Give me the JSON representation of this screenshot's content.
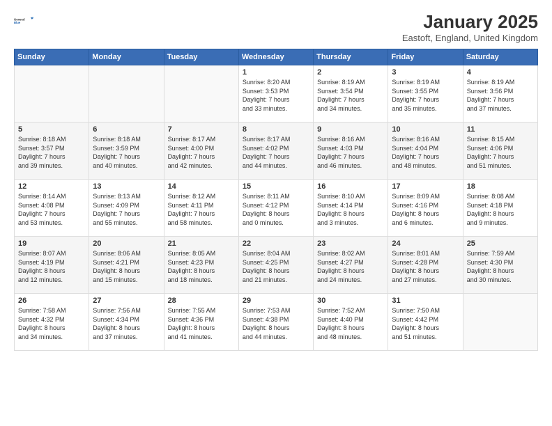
{
  "logo": {
    "line1": "General",
    "line2": "Blue"
  },
  "title": "January 2025",
  "subtitle": "Eastoft, England, United Kingdom",
  "weekdays": [
    "Sunday",
    "Monday",
    "Tuesday",
    "Wednesday",
    "Thursday",
    "Friday",
    "Saturday"
  ],
  "weeks": [
    [
      {
        "day": "",
        "info": ""
      },
      {
        "day": "",
        "info": ""
      },
      {
        "day": "",
        "info": ""
      },
      {
        "day": "1",
        "info": "Sunrise: 8:20 AM\nSunset: 3:53 PM\nDaylight: 7 hours\nand 33 minutes."
      },
      {
        "day": "2",
        "info": "Sunrise: 8:19 AM\nSunset: 3:54 PM\nDaylight: 7 hours\nand 34 minutes."
      },
      {
        "day": "3",
        "info": "Sunrise: 8:19 AM\nSunset: 3:55 PM\nDaylight: 7 hours\nand 35 minutes."
      },
      {
        "day": "4",
        "info": "Sunrise: 8:19 AM\nSunset: 3:56 PM\nDaylight: 7 hours\nand 37 minutes."
      }
    ],
    [
      {
        "day": "5",
        "info": "Sunrise: 8:18 AM\nSunset: 3:57 PM\nDaylight: 7 hours\nand 39 minutes."
      },
      {
        "day": "6",
        "info": "Sunrise: 8:18 AM\nSunset: 3:59 PM\nDaylight: 7 hours\nand 40 minutes."
      },
      {
        "day": "7",
        "info": "Sunrise: 8:17 AM\nSunset: 4:00 PM\nDaylight: 7 hours\nand 42 minutes."
      },
      {
        "day": "8",
        "info": "Sunrise: 8:17 AM\nSunset: 4:02 PM\nDaylight: 7 hours\nand 44 minutes."
      },
      {
        "day": "9",
        "info": "Sunrise: 8:16 AM\nSunset: 4:03 PM\nDaylight: 7 hours\nand 46 minutes."
      },
      {
        "day": "10",
        "info": "Sunrise: 8:16 AM\nSunset: 4:04 PM\nDaylight: 7 hours\nand 48 minutes."
      },
      {
        "day": "11",
        "info": "Sunrise: 8:15 AM\nSunset: 4:06 PM\nDaylight: 7 hours\nand 51 minutes."
      }
    ],
    [
      {
        "day": "12",
        "info": "Sunrise: 8:14 AM\nSunset: 4:08 PM\nDaylight: 7 hours\nand 53 minutes."
      },
      {
        "day": "13",
        "info": "Sunrise: 8:13 AM\nSunset: 4:09 PM\nDaylight: 7 hours\nand 55 minutes."
      },
      {
        "day": "14",
        "info": "Sunrise: 8:12 AM\nSunset: 4:11 PM\nDaylight: 7 hours\nand 58 minutes."
      },
      {
        "day": "15",
        "info": "Sunrise: 8:11 AM\nSunset: 4:12 PM\nDaylight: 8 hours\nand 0 minutes."
      },
      {
        "day": "16",
        "info": "Sunrise: 8:10 AM\nSunset: 4:14 PM\nDaylight: 8 hours\nand 3 minutes."
      },
      {
        "day": "17",
        "info": "Sunrise: 8:09 AM\nSunset: 4:16 PM\nDaylight: 8 hours\nand 6 minutes."
      },
      {
        "day": "18",
        "info": "Sunrise: 8:08 AM\nSunset: 4:18 PM\nDaylight: 8 hours\nand 9 minutes."
      }
    ],
    [
      {
        "day": "19",
        "info": "Sunrise: 8:07 AM\nSunset: 4:19 PM\nDaylight: 8 hours\nand 12 minutes."
      },
      {
        "day": "20",
        "info": "Sunrise: 8:06 AM\nSunset: 4:21 PM\nDaylight: 8 hours\nand 15 minutes."
      },
      {
        "day": "21",
        "info": "Sunrise: 8:05 AM\nSunset: 4:23 PM\nDaylight: 8 hours\nand 18 minutes."
      },
      {
        "day": "22",
        "info": "Sunrise: 8:04 AM\nSunset: 4:25 PM\nDaylight: 8 hours\nand 21 minutes."
      },
      {
        "day": "23",
        "info": "Sunrise: 8:02 AM\nSunset: 4:27 PM\nDaylight: 8 hours\nand 24 minutes."
      },
      {
        "day": "24",
        "info": "Sunrise: 8:01 AM\nSunset: 4:28 PM\nDaylight: 8 hours\nand 27 minutes."
      },
      {
        "day": "25",
        "info": "Sunrise: 7:59 AM\nSunset: 4:30 PM\nDaylight: 8 hours\nand 30 minutes."
      }
    ],
    [
      {
        "day": "26",
        "info": "Sunrise: 7:58 AM\nSunset: 4:32 PM\nDaylight: 8 hours\nand 34 minutes."
      },
      {
        "day": "27",
        "info": "Sunrise: 7:56 AM\nSunset: 4:34 PM\nDaylight: 8 hours\nand 37 minutes."
      },
      {
        "day": "28",
        "info": "Sunrise: 7:55 AM\nSunset: 4:36 PM\nDaylight: 8 hours\nand 41 minutes."
      },
      {
        "day": "29",
        "info": "Sunrise: 7:53 AM\nSunset: 4:38 PM\nDaylight: 8 hours\nand 44 minutes."
      },
      {
        "day": "30",
        "info": "Sunrise: 7:52 AM\nSunset: 4:40 PM\nDaylight: 8 hours\nand 48 minutes."
      },
      {
        "day": "31",
        "info": "Sunrise: 7:50 AM\nSunset: 4:42 PM\nDaylight: 8 hours\nand 51 minutes."
      },
      {
        "day": "",
        "info": ""
      }
    ]
  ]
}
